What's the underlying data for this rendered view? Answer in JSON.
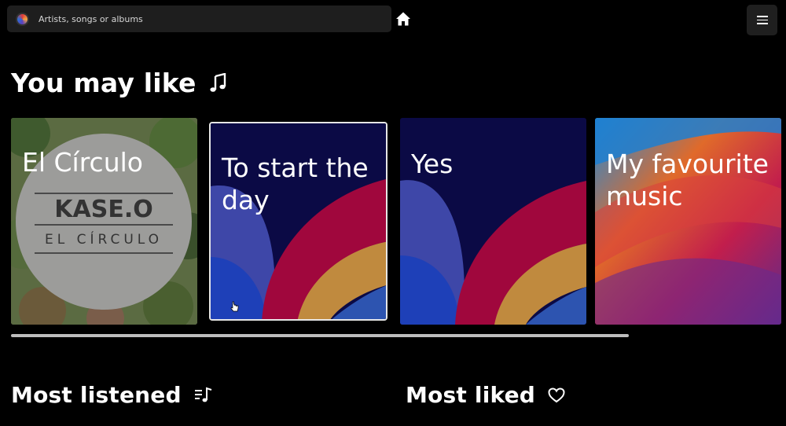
{
  "search": {
    "placeholder": "Artists, songs or albums"
  },
  "sections": {
    "you_may_like": "You may like",
    "most_listened": "Most listened",
    "most_liked": "Most liked"
  },
  "cards": [
    {
      "title": "El Círculo",
      "cover_artist": "KASE.O",
      "cover_album": "EL CÍRCULO"
    },
    {
      "title": "To start the day"
    },
    {
      "title": "Yes"
    },
    {
      "title": "My favourite music"
    }
  ],
  "colors": {
    "background": "#000000",
    "search_bg": "#1e1e1e",
    "card_border": "#e6e6e6"
  },
  "icons": [
    "logo-icon",
    "home-icon",
    "menu-icon",
    "music-note-icon",
    "playlist-icon",
    "heart-icon",
    "cursor-icon"
  ]
}
